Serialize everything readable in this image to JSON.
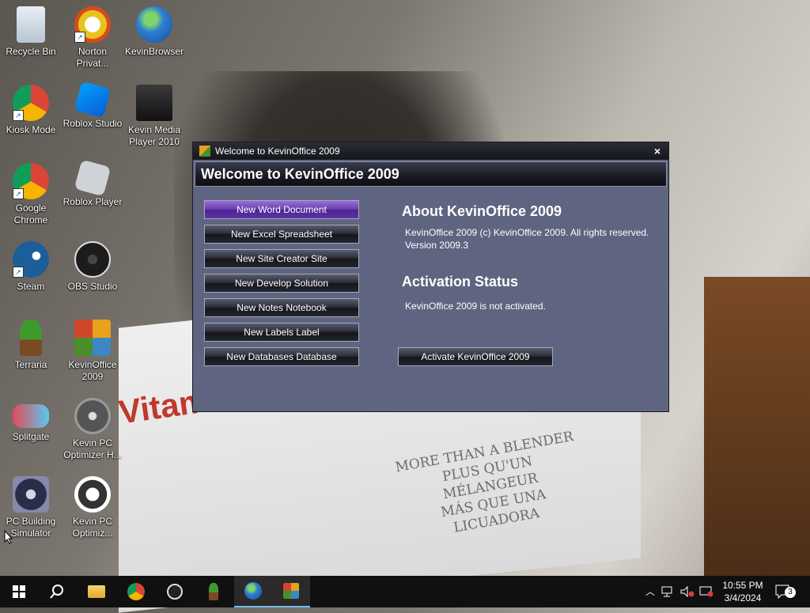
{
  "desktop": {
    "wallpaper_text": [
      "MORE THAN A BLENDER",
      "PLUS QU'UN MÉLANGEUR",
      "MÁS QUE UNA LICUADORA"
    ],
    "wallpaper_brand": "Vitam",
    "icons": [
      {
        "label": "Recycle Bin",
        "icon": "recycle-bin-icon"
      },
      {
        "label": "Norton Privat...",
        "icon": "norton-icon"
      },
      {
        "label": "KevinBrowser",
        "icon": "globe-icon"
      },
      {
        "label": "Kiosk Mode",
        "icon": "chrome-icon"
      },
      {
        "label": "Roblox Studio",
        "icon": "roblox-studio-icon"
      },
      {
        "label": "Kevin Media Player 2010",
        "icon": "media-player-icon"
      },
      {
        "label": "Google Chrome",
        "icon": "chrome-icon"
      },
      {
        "label": "Roblox Player",
        "icon": "roblox-icon"
      },
      {
        "label": "Steam",
        "icon": "steam-icon"
      },
      {
        "label": "OBS Studio",
        "icon": "obs-icon"
      },
      {
        "label": "Terraria",
        "icon": "terraria-icon"
      },
      {
        "label": "KevinOffice 2009",
        "icon": "kevinoffice-icon"
      },
      {
        "label": "Splitgate",
        "icon": "splitgate-icon"
      },
      {
        "label": "Kevin PC Optimizer H...",
        "icon": "speedometer-icon"
      },
      {
        "label": "PC Building Simulator",
        "icon": "fan-icon"
      },
      {
        "label": "Kevin PC Optimiz...",
        "icon": "gear-check-icon"
      }
    ]
  },
  "dialog": {
    "title": "Welcome to KevinOffice 2009",
    "header": "Welcome to KevinOffice 2009",
    "close_label": "×",
    "buttons": [
      "New Word Document",
      "New Excel Spreadsheet",
      "New Site Creator Site",
      "New Develop Solution",
      "New Notes Notebook",
      "New Labels Label",
      "New Databases Database"
    ],
    "about_title": "About KevinOffice 2009",
    "about_line1": "KevinOffice 2009 (c) KevinOffice 2009. All rights reserved.",
    "about_line2": "Version 2009.3",
    "activation_title": "Activation Status",
    "activation_text": "KevinOffice 2009 is not activated.",
    "activate_button": "Activate KevinOffice 2009"
  },
  "taskbar": {
    "time": "10:55 PM",
    "date": "3/4/2024",
    "notification_count": "3",
    "items": [
      "start-icon",
      "search-icon",
      "file-explorer-icon",
      "chrome-icon",
      "obs-icon",
      "terraria-icon",
      "globe-icon",
      "kevinoffice-icon"
    ]
  },
  "colors": {
    "dialog_bg": "#5f6481",
    "active_button": "#6a3fb0",
    "taskbar": "#101010"
  }
}
